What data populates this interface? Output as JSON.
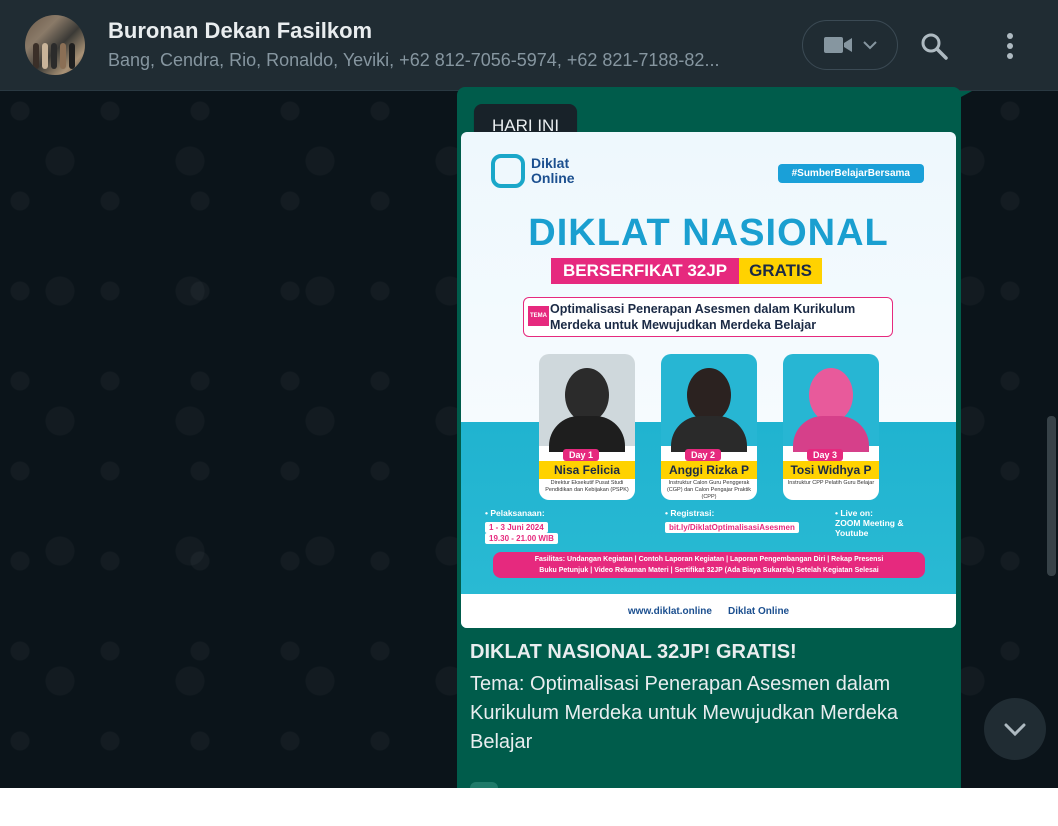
{
  "header": {
    "title": "Buronan Dekan Fasilkom",
    "members": "Bang, Cendra, Rio, Ronaldo, Yeviki, +62 812-7056-5974, +62 821-7188-82..."
  },
  "date_chip": "HARI INI",
  "poster": {
    "logo_line1": "Diklat",
    "logo_line2": "Online",
    "hashtag": "#SumberBelajarBersama",
    "title": "DIKLAT NASIONAL",
    "cert_a": "BERSERFIKAT 32JP",
    "cert_b": "GRATIS",
    "theme_tag": "TEMA",
    "theme": "Optimalisasi Penerapan Asesmen dalam Kurikulum Merdeka untuk Mewujudkan Merdeka Belajar",
    "speakers": [
      {
        "day": "Day 1",
        "name": "Nisa Felicia",
        "role": "Direktur Eksekutif Pusat Studi Pendidikan dan Kebijakan (PSPK)"
      },
      {
        "day": "Day 2",
        "name": "Anggi Rizka P",
        "role": "Instruktur Calon Guru Penggerak (CGP) dan Calon Pengajar Praktik (CPP)"
      },
      {
        "day": "Day 3",
        "name": "Tosi Widhya P",
        "role": "Instruktur CPP Pelatih Guru Belajar"
      }
    ],
    "pelaksanaan_label": "• Pelaksanaan:",
    "pelaksanaan_date": "1 - 3 Juni 2024",
    "pelaksanaan_time": "19.30 - 21.00 WIB",
    "registrasi_label": "• Registrasi:",
    "registrasi_link": "bit.ly/DiklatOptimalisasiAsesmen",
    "live_label": "• Live on:",
    "live_value": "ZOOM Meeting & Youtube",
    "fasilitas_line1": "Fasilitas: Undangan Kegiatan | Contoh Laporan Kegiatan | Laporan Pengembangan Diri | Rekap Presensi",
    "fasilitas_line2": "Buku Petunjuk | Video Rekaman Materi | Sertifikat 32JP (Ada Biaya Sukarela) Setelah Kegiatan Selesai",
    "website": "www.diklat.online",
    "social": "Diklat Online"
  },
  "message": {
    "title": "DIKLAT NASIONAL 32JP! GRATIS!",
    "body": "Tema: Optimalisasi Penerapan Asesmen dalam Kurikulum Merdeka untuk Mewujudkan Merdeka Belajar"
  },
  "colors": {
    "header_bg": "#202c33",
    "chat_bg": "#0b141a",
    "bubble_out": "#005c4b",
    "text_primary": "#e9edef",
    "text_secondary": "#8696a0"
  }
}
